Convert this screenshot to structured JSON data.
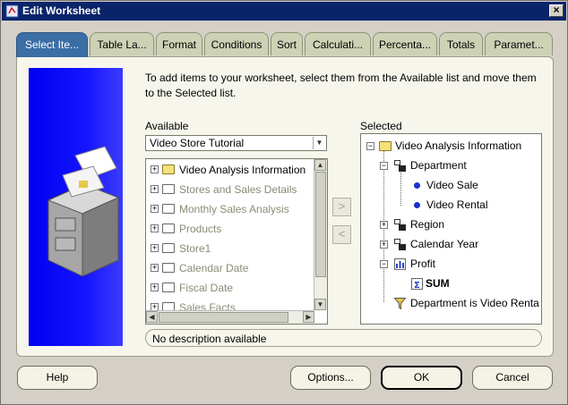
{
  "window": {
    "title": "Edit Worksheet",
    "close_glyph": "×"
  },
  "tabs": [
    {
      "label": "Select Ite...",
      "active": true
    },
    {
      "label": "Table La...",
      "active": false
    },
    {
      "label": "Format",
      "active": false
    },
    {
      "label": "Conditions",
      "active": false
    },
    {
      "label": "Sort",
      "active": false
    },
    {
      "label": "Calculati...",
      "active": false
    },
    {
      "label": "Percenta...",
      "active": false
    },
    {
      "label": "Totals",
      "active": false
    },
    {
      "label": "Paramet...",
      "active": false
    }
  ],
  "instructions": "To add items to your worksheet, select them from the Available list and move them to the Selected list.",
  "available": {
    "label": "Available",
    "combo_value": "Video Store Tutorial",
    "items": [
      {
        "label": "Video Analysis Information",
        "enabled": true
      },
      {
        "label": "Stores and Sales Details",
        "enabled": false
      },
      {
        "label": "Monthly Sales Analysis",
        "enabled": false
      },
      {
        "label": "Products",
        "enabled": false
      },
      {
        "label": "Store1",
        "enabled": false
      },
      {
        "label": "Calendar Date",
        "enabled": false
      },
      {
        "label": "Fiscal Date",
        "enabled": false
      },
      {
        "label": "Sales Facts",
        "enabled": false
      }
    ]
  },
  "move_buttons": {
    "add_glyph": ">",
    "remove_glyph": "<"
  },
  "selected": {
    "label": "Selected",
    "items": [
      {
        "label": "Video Analysis Information",
        "icon": "folder-icon",
        "bold": false
      },
      {
        "label": "Department",
        "icon": "hierarchy-icon",
        "bold": false
      },
      {
        "label": "Video Sale",
        "icon": "value-dot-icon",
        "bold": false
      },
      {
        "label": "Video Rental",
        "icon": "value-dot-icon",
        "bold": false
      },
      {
        "label": "Region",
        "icon": "hierarchy-icon",
        "bold": false
      },
      {
        "label": "Calendar Year",
        "icon": "hierarchy-icon",
        "bold": false
      },
      {
        "label": "Profit",
        "icon": "measure-icon",
        "bold": false
      },
      {
        "label": "SUM",
        "icon": "sum-icon",
        "bold": true
      },
      {
        "label": "Department is Video Renta",
        "icon": "filter-funnel-icon",
        "bold": false
      }
    ]
  },
  "description": "No description available",
  "buttons": {
    "help": "Help",
    "options": "Options...",
    "ok": "OK",
    "cancel": "Cancel"
  }
}
